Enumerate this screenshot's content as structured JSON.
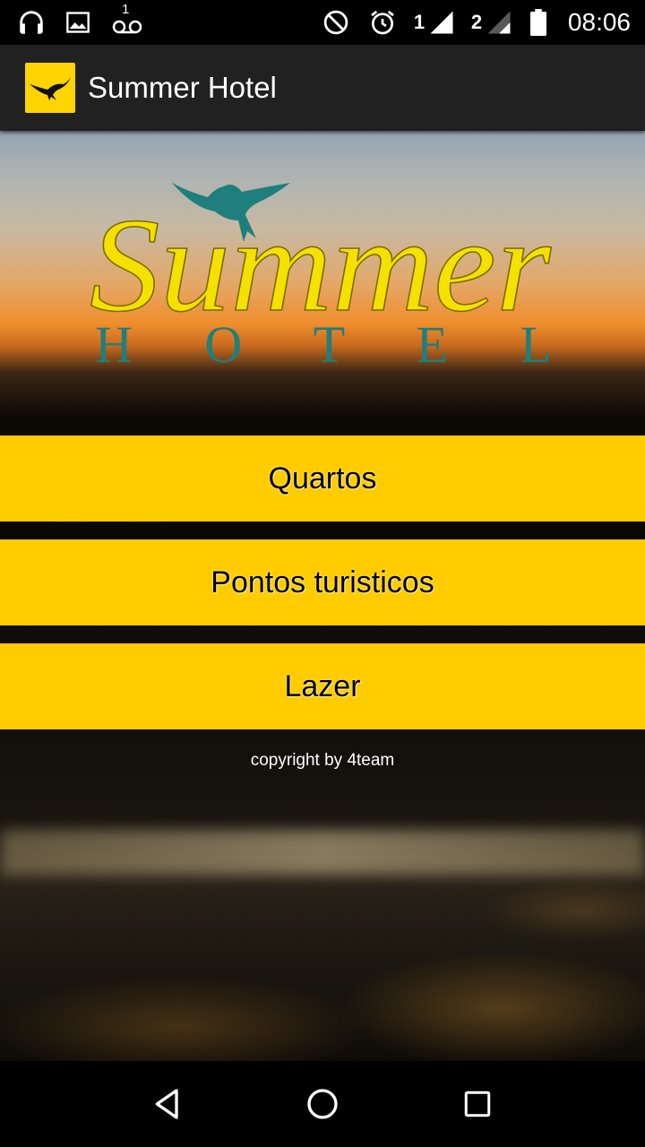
{
  "status_bar": {
    "time": "08:06",
    "sim1_label": "1",
    "sim2_label": "2",
    "voicemail_count": "1",
    "left_icons": [
      "headphones-icon",
      "image-icon",
      "voicemail-icon"
    ],
    "right_icons": [
      "do-not-disturb-icon",
      "alarm-icon",
      "signal-icon",
      "signal-icon",
      "battery-icon"
    ]
  },
  "action_bar": {
    "title": "Summer Hotel"
  },
  "logo": {
    "script_text": "Summer",
    "sub_text": "H O T E L"
  },
  "menu": {
    "items": [
      {
        "label": "Quartos"
      },
      {
        "label": "Pontos turisticos"
      },
      {
        "label": "Lazer"
      }
    ]
  },
  "footer": {
    "copyright": "copyright by 4team"
  },
  "colors": {
    "button_yellow": "#ffcc00",
    "logo_yellow": "#f5e100",
    "logo_teal": "#1f7f7c",
    "action_bar": "#212121"
  }
}
